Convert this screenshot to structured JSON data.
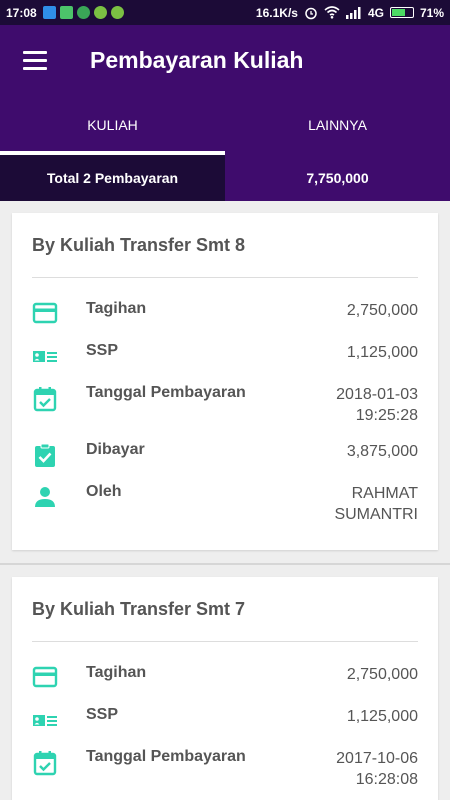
{
  "status_bar": {
    "time": "17:08",
    "speed": "16.1K/s",
    "network": "4G",
    "battery": "71%",
    "battery_level": 0.71
  },
  "app_bar": {
    "title": "Pembayaran Kuliah",
    "menu_icon": "hamburger-menu-icon"
  },
  "tabs": [
    {
      "label": "KULIAH",
      "active": true
    },
    {
      "label": "LAINNYA",
      "active": false
    }
  ],
  "summary": {
    "label": "Total 2 Pembayaran",
    "total": "7,750,000"
  },
  "accent_color": "#2ed3b1",
  "primary_color": "#3f0c6d",
  "cards": [
    {
      "title": "By Kuliah Transfer Smt 8",
      "rows": [
        {
          "icon": "credit-card-icon",
          "label": "Tagihan",
          "value": "2,750,000"
        },
        {
          "icon": "id-card-icon",
          "label": "SSP",
          "value": "1,125,000"
        },
        {
          "icon": "calendar-check-icon",
          "label": "Tanggal Pembayaran",
          "value_line1": "2018-01-03",
          "value_line2": "19:25:28"
        },
        {
          "icon": "clipboard-check-icon",
          "label": "Dibayar",
          "value": "3,875,000"
        },
        {
          "icon": "person-icon",
          "label": "Oleh",
          "value_line1": "RAHMAT",
          "value_line2": "SUMANTRI"
        }
      ]
    },
    {
      "title": "By Kuliah Transfer Smt 7",
      "rows": [
        {
          "icon": "credit-card-icon",
          "label": "Tagihan",
          "value": "2,750,000"
        },
        {
          "icon": "id-card-icon",
          "label": "SSP",
          "value": "1,125,000"
        },
        {
          "icon": "calendar-check-icon",
          "label": "Tanggal Pembayaran",
          "value_line1": "2017-10-06",
          "value_line2": "16:28:08"
        }
      ]
    }
  ]
}
